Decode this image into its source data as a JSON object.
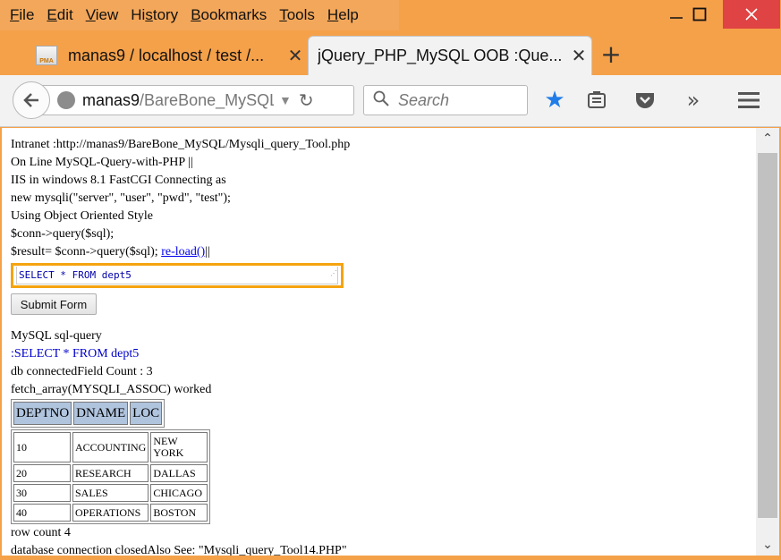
{
  "menu": [
    {
      "label": "File",
      "accel": "F",
      "rest": "ile"
    },
    {
      "label": "Edit",
      "accel": "E",
      "rest": "dit"
    },
    {
      "label": "View",
      "accel": "V",
      "rest": "iew"
    },
    {
      "label": "History",
      "accel": "s",
      "pre": "Hi",
      "rest": "tory"
    },
    {
      "label": "Bookmarks",
      "accel": "B",
      "rest": "ookmarks"
    },
    {
      "label": "Tools",
      "accel": "T",
      "rest": "ools"
    },
    {
      "label": "Help",
      "accel": "H",
      "rest": "elp"
    }
  ],
  "tabs": [
    {
      "title": "manas9 / localhost / test /...",
      "icon_text": "PMA"
    },
    {
      "title": "jQuery_PHP_MySQL OOB :Que..."
    }
  ],
  "nav": {
    "url_host": "manas9",
    "url_path": "/BareBone_MySQL/Mysqli_query_Tool.php",
    "search_placeholder": "Search"
  },
  "page": {
    "lines": [
      "Intranet :http://manas9/BareBone_MySQL/Mysqli_query_Tool.php",
      "On Line MySQL-Query-with-PHP ||",
      "IIS in windows 8.1 FastCGI Connecting as",
      "new mysqli(\"server\", \"user\", \"pwd\", \"test\");",
      "Using Object Oriented Style",
      "$conn->query($sql);"
    ],
    "result_line_prefix": "$result= $conn->query($sql); ",
    "reload_link": "re-load()",
    "reload_suffix": "||",
    "query_value": "SELECT * FROM dept5",
    "submit_label": "Submit Form",
    "result_heading": "MySQL sql-query",
    "result_query": ":SELECT * FROM dept5",
    "field_count_line": "db connectedField Count : 3",
    "fetch_line": "fetch_array(MYSQLI_ASSOC) worked",
    "headers": [
      "DEPTNO",
      "DNAME",
      "LOC"
    ],
    "rows": [
      [
        "10",
        "ACCOUNTING",
        "NEW YORK"
      ],
      [
        "20",
        "RESEARCH",
        "DALLAS"
      ],
      [
        "30",
        "SALES",
        "CHICAGO"
      ],
      [
        "40",
        "OPERATIONS",
        "BOSTON"
      ]
    ],
    "row_count_line": "row count 4",
    "closing_line": "database connection closedAlso See: \"Mysqli_query_Tool14.PHP\""
  },
  "colors": {
    "frame": "#f5a14a",
    "highlight_border": "#f5a30f",
    "header_cell": "#b0c4de",
    "link": "#0000ee"
  }
}
